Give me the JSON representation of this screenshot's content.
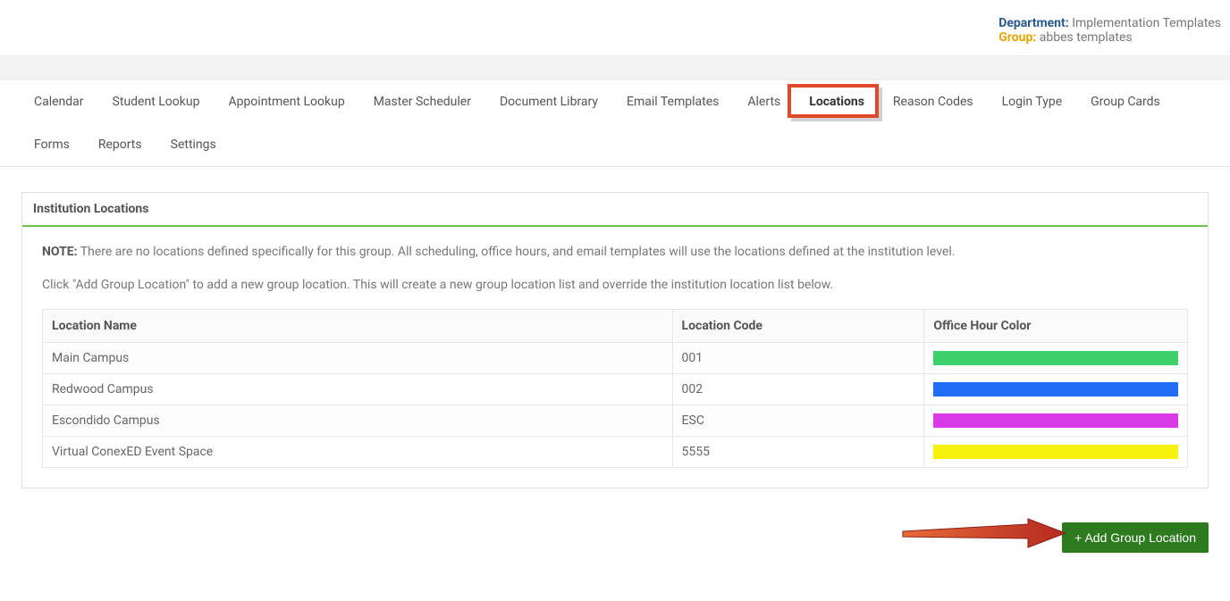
{
  "header": {
    "department_label": "Department:",
    "department_value": "Implementation Templates",
    "group_label": "Group:",
    "group_value": "abbes templates"
  },
  "tabs": [
    {
      "label": "Calendar"
    },
    {
      "label": "Student Lookup"
    },
    {
      "label": "Appointment Lookup"
    },
    {
      "label": "Master Scheduler"
    },
    {
      "label": "Document Library"
    },
    {
      "label": "Email Templates"
    },
    {
      "label": "Alerts"
    },
    {
      "label": "Locations",
      "active": true
    },
    {
      "label": "Reason Codes"
    },
    {
      "label": "Login Type"
    },
    {
      "label": "Group Cards"
    },
    {
      "label": "Forms"
    },
    {
      "label": "Reports"
    },
    {
      "label": "Settings"
    }
  ],
  "panel": {
    "title": "Institution Locations",
    "note_label": "NOTE:",
    "note_text": "There are no locations defined specifically for this group. All scheduling, office hours, and email templates will use the locations defined at the institution level.",
    "instruction_text": "Click \"Add Group Location\" to add a new group location. This will create a new group location list and override the institution location list below."
  },
  "table": {
    "headers": {
      "name": "Location Name",
      "code": "Location Code",
      "color": "Office Hour Color"
    },
    "rows": [
      {
        "name": "Main Campus",
        "code": "001",
        "color": "#3fcf6b"
      },
      {
        "name": "Redwood Campus",
        "code": "002",
        "color": "#1f6ef5"
      },
      {
        "name": "Escondido Campus",
        "code": "ESC",
        "color": "#d93ae6"
      },
      {
        "name": "Virtual ConexED Event Space",
        "code": "5555",
        "color": "#f7f20b"
      }
    ]
  },
  "actions": {
    "add_group_location": "+ Add Group Location"
  }
}
